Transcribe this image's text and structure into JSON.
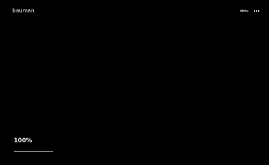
{
  "header": {
    "logo_text": "bauman",
    "menu_label": "Menu",
    "menu_icon": "more-dots-icon"
  },
  "loader": {
    "percent_text": "100%",
    "progress": 1.0
  },
  "colors": {
    "background": "#000000",
    "text": "#ffffff",
    "track": "#3a3a3a",
    "fill": "#8a8a8a"
  }
}
